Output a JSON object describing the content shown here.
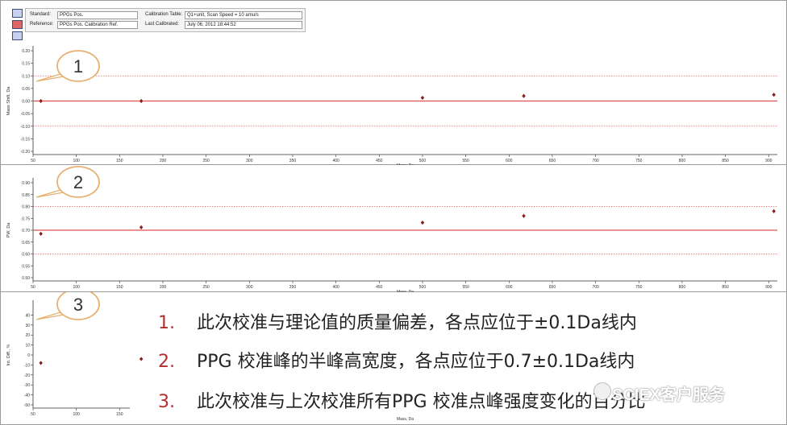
{
  "header": {
    "standard_label": "Standard:",
    "standard_value": "PPGs Pos.",
    "reference_label": "Reference:",
    "reference_value": "PPGs Pos. Calibration Ref.",
    "cal_table_label": "Calibration Table:",
    "cal_table_value": "Q1+unit, Scan Speed = 10 amu/s",
    "last_cal_label": "Last Calibrated:",
    "last_cal_value": "July 06, 2012 18:44:52"
  },
  "toolbar_icons": [
    "document-icon",
    "chart-icon",
    "save-icon"
  ],
  "colors": {
    "target_line": "#e05050",
    "limit_line": "#e06060",
    "point": "#8b1a1a",
    "callout": "#e6b070",
    "note_number": "#b03030"
  },
  "chart_data": [
    {
      "type": "scatter",
      "ylabel": "Mass Shift, Da",
      "xlabel": "Mass, Da",
      "xlim": [
        50,
        910
      ],
      "ylim": [
        -0.2,
        0.2
      ],
      "x_ticks": [
        "50",
        "100",
        "150",
        "200",
        "250",
        "300",
        "350",
        "400",
        "450",
        "500",
        "550",
        "600",
        "650",
        "700",
        "750",
        "800",
        "850",
        "900"
      ],
      "y_ticks": [
        "0.20",
        "0.15",
        "0.10",
        "0.05",
        "0.00",
        "-0.05",
        "-0.10",
        "-0.15",
        "-0.20"
      ],
      "target": 0.0,
      "limits": [
        0.1,
        -0.1
      ],
      "x": [
        59,
        175,
        500,
        617,
        906
      ],
      "y": [
        0.0,
        0.0,
        0.013,
        0.02,
        0.025
      ],
      "callout": "1"
    },
    {
      "type": "scatter",
      "ylabel": "PW, Da",
      "xlabel": "Mass, Da",
      "xlim": [
        50,
        910
      ],
      "ylim": [
        0.5,
        0.9
      ],
      "x_ticks": [
        "50",
        "100",
        "150",
        "200",
        "250",
        "300",
        "350",
        "400",
        "450",
        "500",
        "550",
        "600",
        "650",
        "700",
        "750",
        "800",
        "850",
        "900"
      ],
      "y_ticks": [
        "0.90",
        "0.85",
        "0.80",
        "0.75",
        "0.70",
        "0.65",
        "0.60",
        "0.55",
        "0.50"
      ],
      "target": 0.7,
      "limits": [
        0.8,
        0.6
      ],
      "x": [
        59,
        175,
        500,
        617,
        906
      ],
      "y": [
        0.685,
        0.712,
        0.732,
        0.76,
        0.78
      ],
      "callout": "2"
    },
    {
      "type": "scatter",
      "ylabel": "Int. Diff., %",
      "xlabel": "Mass, Da",
      "xlim": [
        50,
        910
      ],
      "ylim": [
        -50,
        50
      ],
      "x_ticks": [
        "50",
        "100",
        "150"
      ],
      "y_ticks": [
        "40",
        "30",
        "20",
        "10",
        "0",
        "-10",
        "-20",
        "-30",
        "-40",
        "-50"
      ],
      "x": [
        59,
        175
      ],
      "y": [
        -8,
        -4
      ],
      "callout": "3"
    }
  ],
  "notes": [
    {
      "num": "1.",
      "text": "此次校准与理论值的质量偏差，各点应位于±0.1Da线内"
    },
    {
      "num": "2.",
      "text": "PPG 校准峰的半峰高宽度，各点应位于0.7±0.1Da线内"
    },
    {
      "num": "3.",
      "text": "此次校准与上次校准所有PPG 校准点峰强度变化的百分比"
    }
  ],
  "watermark": "SCIEX客户服务"
}
